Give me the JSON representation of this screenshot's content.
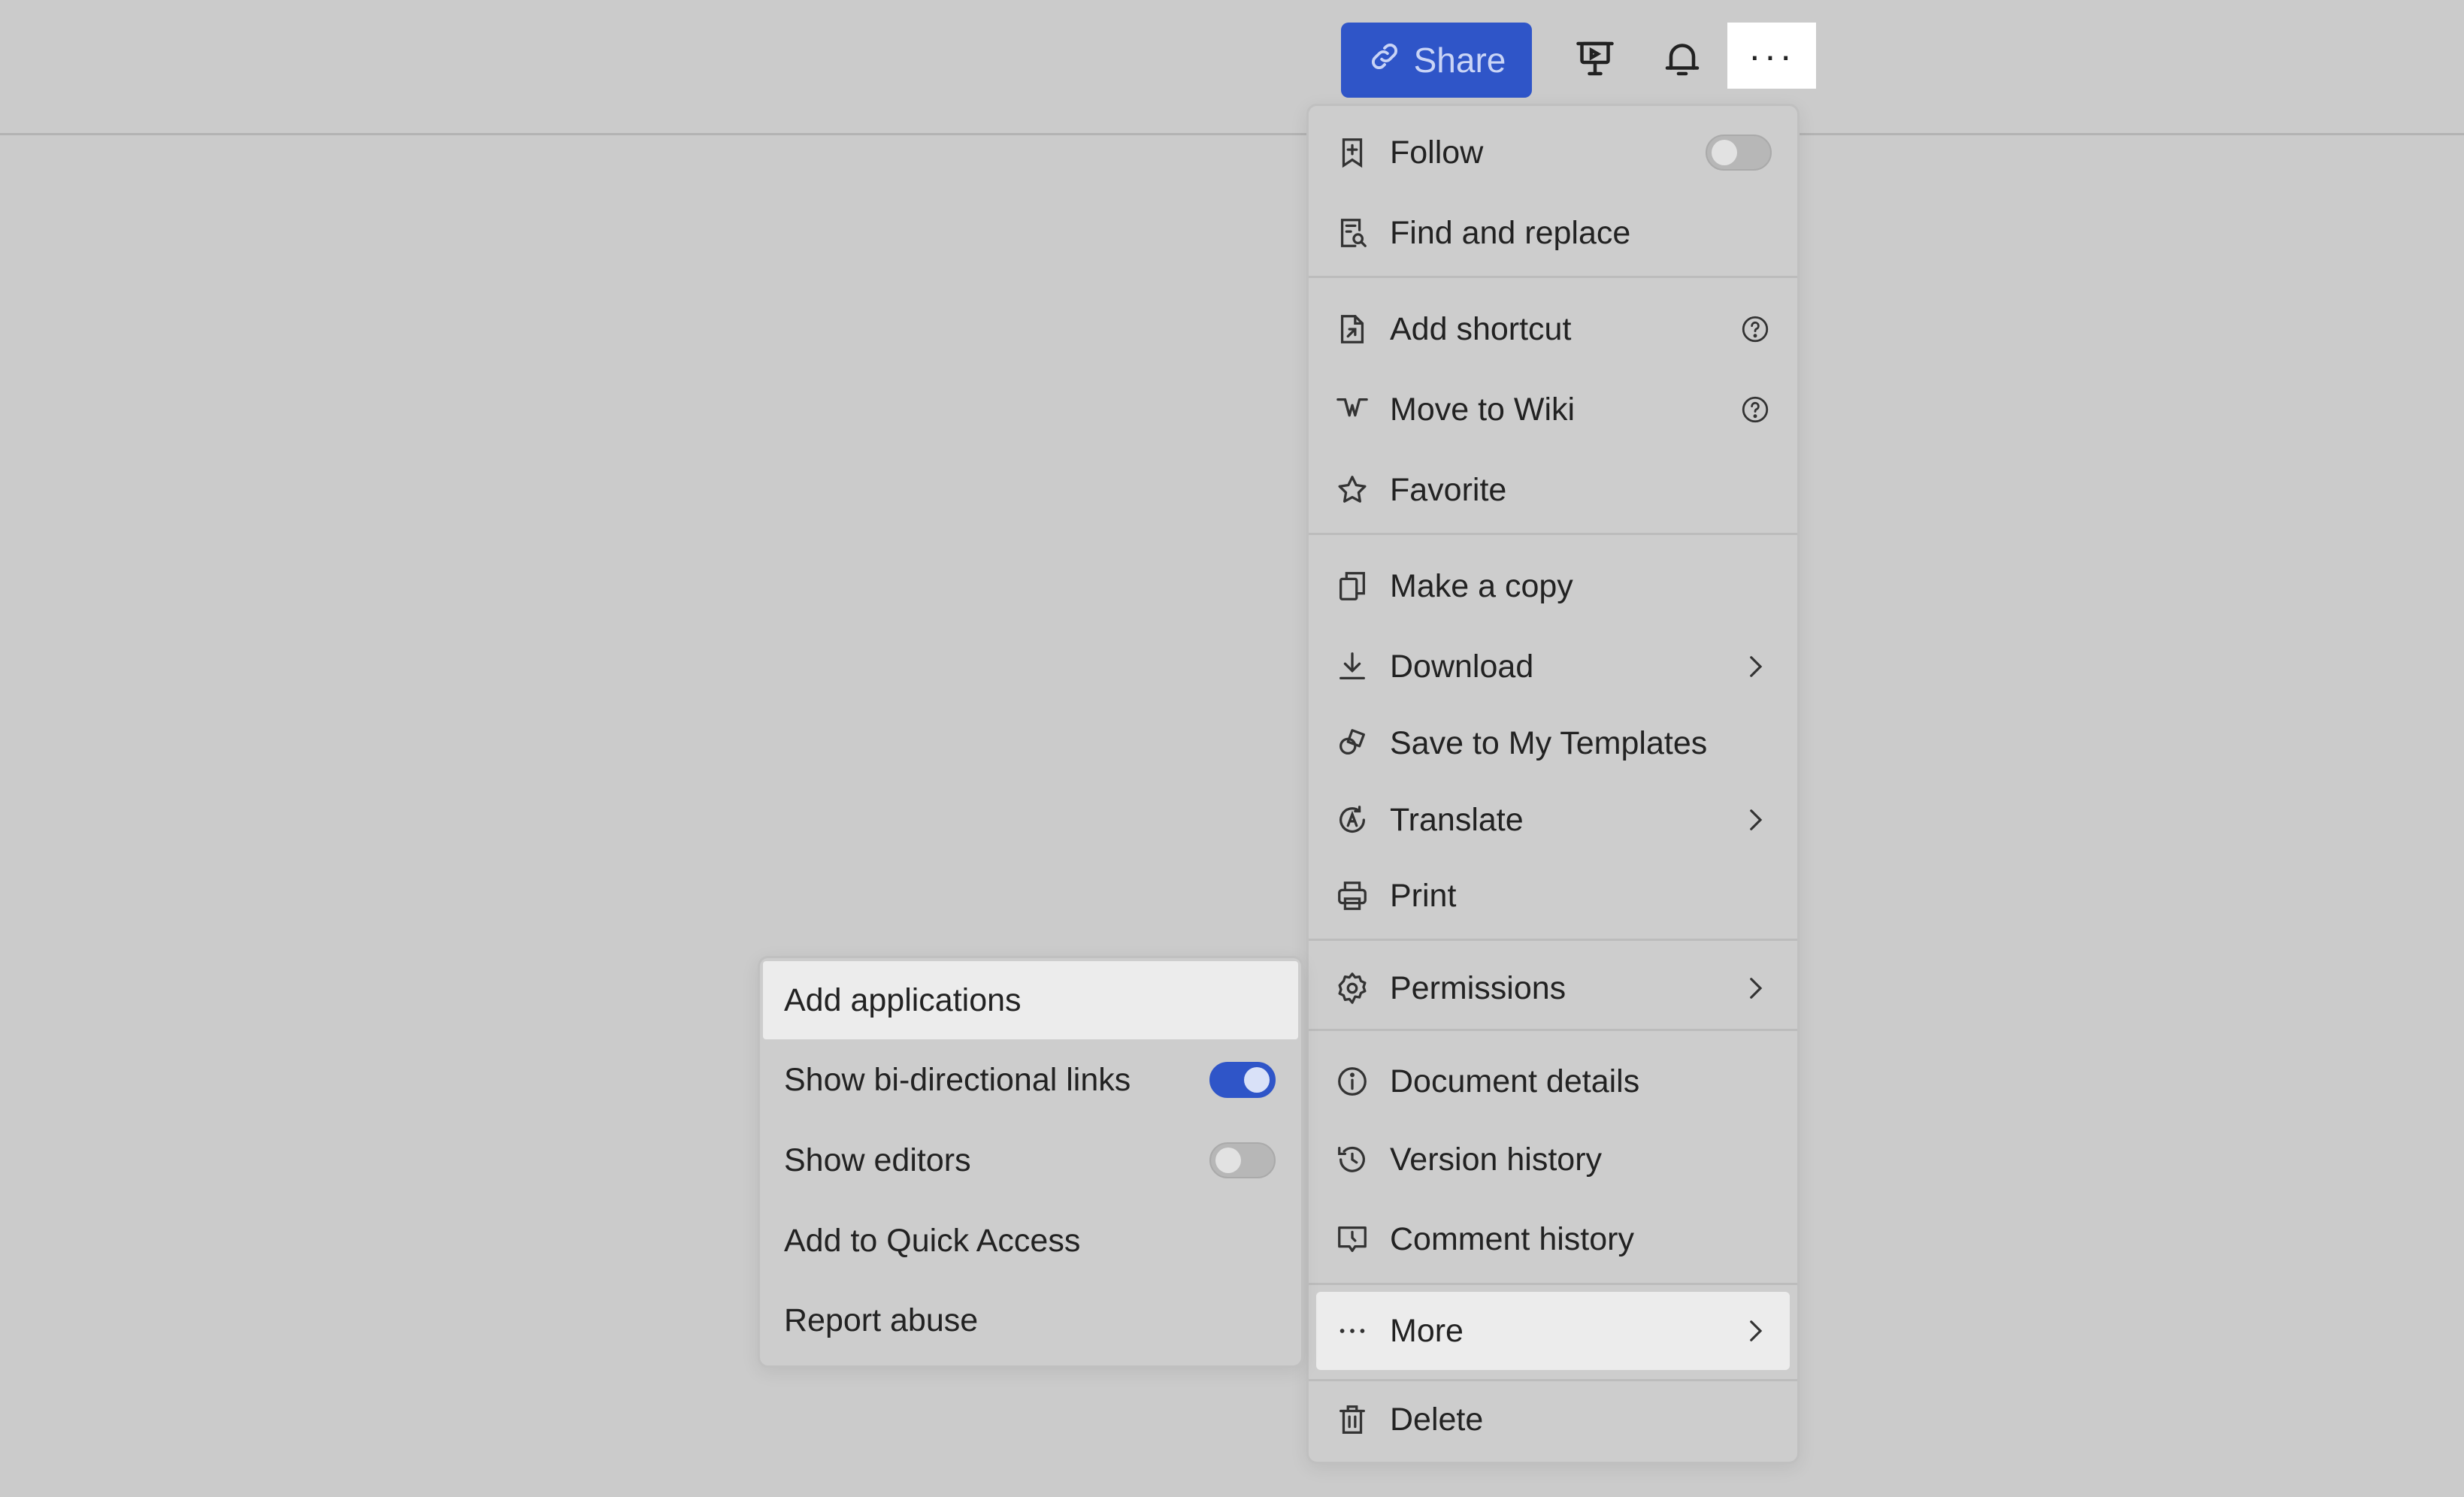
{
  "header": {
    "share_label": "Share",
    "presentation_icon": "presentation-icon",
    "notification_icon": "bell-icon",
    "more_label": "···"
  },
  "main_menu": {
    "items": [
      {
        "label": "Follow",
        "icon": "bookmark-add-icon",
        "toggle": false
      },
      {
        "label": "Find and replace",
        "icon": "find-replace-icon"
      },
      {
        "label": "Add shortcut",
        "icon": "shortcut-icon",
        "help": true
      },
      {
        "label": "Move to Wiki",
        "icon": "wiki-icon",
        "help": true
      },
      {
        "label": "Favorite",
        "icon": "star-icon"
      },
      {
        "label": "Make a copy",
        "icon": "copy-icon"
      },
      {
        "label": "Download",
        "icon": "download-icon",
        "submenu": true
      },
      {
        "label": "Save to My Templates",
        "icon": "template-icon"
      },
      {
        "label": "Translate",
        "icon": "translate-icon",
        "submenu": true
      },
      {
        "label": "Print",
        "icon": "printer-icon"
      },
      {
        "label": "Permissions",
        "icon": "gear-icon",
        "submenu": true
      },
      {
        "label": "Document details",
        "icon": "info-icon"
      },
      {
        "label": "Version history",
        "icon": "history-icon"
      },
      {
        "label": "Comment history",
        "icon": "comment-history-icon"
      },
      {
        "label": "More",
        "icon": "more-dots-icon",
        "submenu": true,
        "highlighted": true
      },
      {
        "label": "Delete",
        "icon": "trash-icon"
      }
    ]
  },
  "sub_menu": {
    "items": [
      {
        "label": "Add applications",
        "highlighted": true
      },
      {
        "label": "Show bi-directional links",
        "toggle": true
      },
      {
        "label": "Show editors",
        "toggle": false
      },
      {
        "label": "Add to Quick Access"
      },
      {
        "label": "Report abuse"
      }
    ]
  },
  "colors": {
    "accent": "#2f55c8",
    "background": "#cbcbcb",
    "menu_background": "#cdcdcd",
    "highlight": "#ececec"
  }
}
